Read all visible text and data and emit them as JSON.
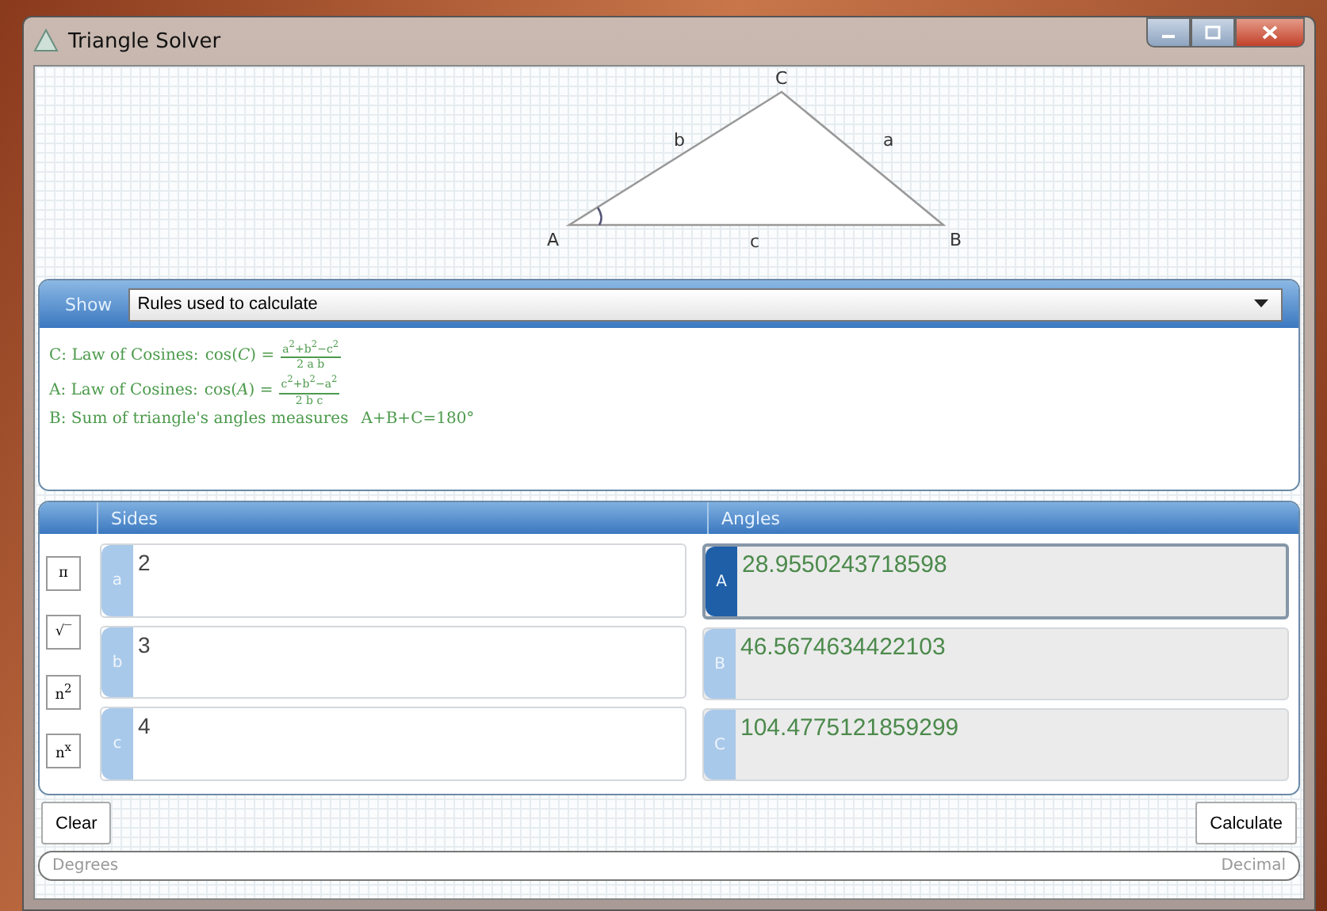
{
  "window": {
    "title": "Triangle Solver"
  },
  "triangle": {
    "vertices": [
      "A",
      "B",
      "C"
    ],
    "sides": [
      "a",
      "b",
      "c"
    ]
  },
  "show": {
    "label": "Show",
    "value": "Rules used to calculate"
  },
  "rules": [
    {
      "kind": "fraction",
      "label": "C: Law of Cosines:",
      "formula": "cos(*C*) =",
      "numerator": "a$^{2}$+b$^{2}$−c$^{2}$",
      "denominator": "2 a b"
    },
    {
      "kind": "fraction",
      "label": "A: Law of Cosines:",
      "formula": "cos(*A*) =",
      "numerator": "c$^{2}$+b$^{2}$−a$^{2}$",
      "denominator": "2 b c"
    },
    {
      "kind": "plain",
      "label": "B: Sum of triangle's angles measures",
      "formula": "A+B+C=180°"
    }
  ],
  "tools": [
    "π",
    "√‾",
    "n$^{2}$",
    "n$^{x}$"
  ],
  "sides_header": "Sides",
  "angles_header": "Angles",
  "sides": [
    {
      "label": "a",
      "value": "2",
      "selected": false
    },
    {
      "label": "b",
      "value": "3",
      "selected": false
    },
    {
      "label": "c",
      "value": "4",
      "selected": false
    }
  ],
  "angles": [
    {
      "label": "A",
      "value": "28.9550243718598",
      "selected": true
    },
    {
      "label": "B",
      "value": "46.5674634422103",
      "selected": false
    },
    {
      "label": "C",
      "value": "104.4775121859299",
      "selected": false
    }
  ],
  "buttons": {
    "clear": "Clear",
    "calculate": "Calculate"
  },
  "status_bar": {
    "left": "Degrees",
    "right": "Decimal"
  }
}
